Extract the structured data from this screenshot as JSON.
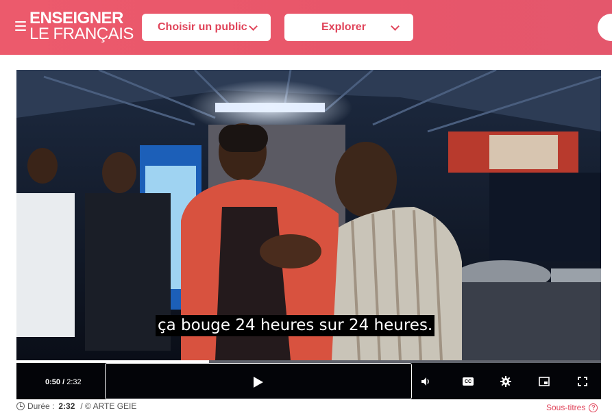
{
  "header": {
    "logo_line1": "ENSEIGNER",
    "logo_line2": "LE FRANÇAIS",
    "nav": [
      {
        "label": "Choisir un public"
      },
      {
        "label": "Explorer"
      }
    ]
  },
  "player": {
    "subtitle": "ça bouge 24 heures sur 24 heures.",
    "current_time": "0:50",
    "separator": "/",
    "duration": "2:32",
    "progress": 0.329,
    "icons": [
      "play-icon",
      "volume-icon",
      "captions-icon",
      "settings-icon",
      "picture-in-picture-icon",
      "fullscreen-icon"
    ],
    "captions_label": "CC"
  },
  "meta": {
    "duration_label": "Durée :",
    "duration_value": "2:32",
    "credit": "/ © ARTE GEIE",
    "subtitles_link": "Sous-titres",
    "help_glyph": "?"
  },
  "colors": {
    "brand": "#e8566a",
    "accent_text": "#e0445a"
  }
}
